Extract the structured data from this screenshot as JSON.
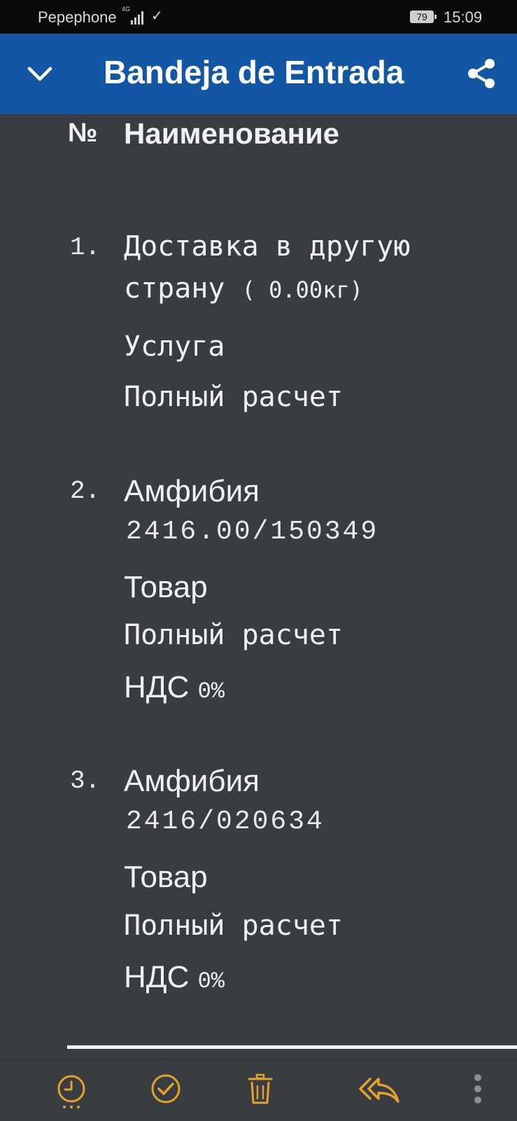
{
  "status_bar": {
    "carrier": "Pepephone",
    "network": "4G",
    "battery": "79",
    "time": "15:09"
  },
  "app_bar": {
    "title": "Bandeja de Entrada"
  },
  "table": {
    "header_no": "№",
    "header_name": "Наименование",
    "items": [
      {
        "number": "1.",
        "name_line1": "Доставка в другую",
        "name_line2": "страну",
        "weight": "( 0.00кг)",
        "type": "Услуга",
        "payment": "Полный расчет"
      },
      {
        "number": "2.",
        "name": "Амфибия",
        "code": "2416.00/150349",
        "type": "Товар",
        "payment": "Полный расчет",
        "vat_label": "НДС",
        "vat_value": "0%"
      },
      {
        "number": "3.",
        "name": "Амфибия",
        "code": "2416/020634",
        "type": "Товар",
        "payment": "Полный расчет",
        "vat_label": "НДС",
        "vat_value": "0%"
      }
    ]
  },
  "toolbar": {
    "icons": [
      "snooze-icon",
      "done-icon",
      "delete-icon",
      "reply-all-icon",
      "more-icon"
    ],
    "accent": "#e3a32b"
  }
}
